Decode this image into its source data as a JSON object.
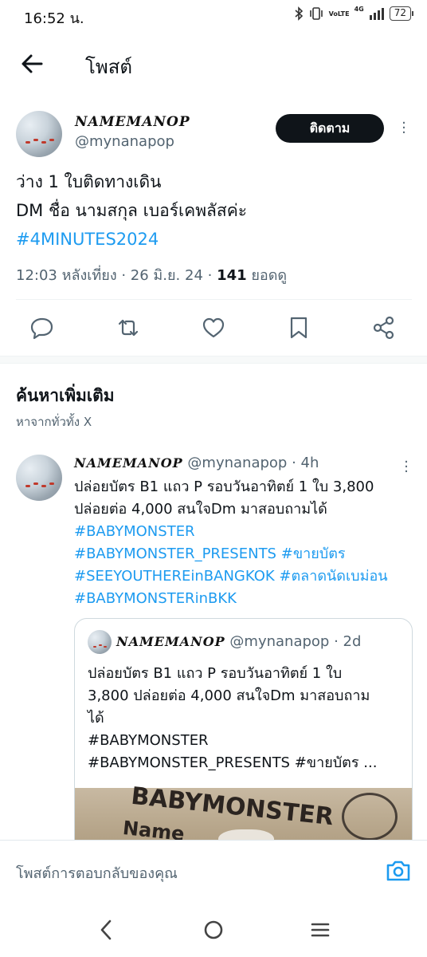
{
  "status_bar": {
    "time": "16:52 น.",
    "network": "VoLTE",
    "network_type": "4G",
    "battery": "72"
  },
  "header": {
    "title": "โพสต์",
    "back_icon": "arrow-left-icon"
  },
  "post": {
    "author_name": "NAMEMANOP",
    "handle": "@mynanapop",
    "follow_label": "ติดตาม",
    "lines": [
      "ว่าง 1 ใบติดทางเดิน",
      "DM ชื่อ นามสกุล เบอร์เคพลัสค่ะ"
    ],
    "hashtag": "#4MINUTES2024",
    "time": "12:03 หลังเที่ยง · 26 มิ.ย. 24 · ",
    "views_count": "141",
    "views_label": " ยอดดู",
    "actions": [
      "reply-icon",
      "retweet-icon",
      "like-icon",
      "bookmark-icon",
      "share-icon"
    ]
  },
  "discover": {
    "title": "ค้นหาเพิ่มเติม",
    "subtitle": "หาจากทั่วทั้ง X"
  },
  "tweet2": {
    "author_name": "NAMEMANOP",
    "handle": "@mynanapop",
    "time": " · 4h",
    "text_line1": "ปล่อยบัตร B1 แถว P รอบวันอาทิตย์ 1 ใบ 3,800",
    "text_line2": "ปล่อยต่อ 4,000 สนใจDm มาสอบถามได้",
    "tag1": "#BABYMONSTER",
    "tag2": "#BABYMONSTER_PRESENTS",
    "tag3": "#ขายบัตร",
    "tag4": "#SEEYOUTHEREinBANGKOK",
    "tag5": "#ตลาดนัดเบม่อน",
    "tag6": "#BABYMONSTERinBKK"
  },
  "quote": {
    "author_name": "NAMEMANOP",
    "handle": "@mynanapop",
    "time": " · 2d",
    "line1": "ปล่อยบัตร B1 แถว P รอบวันอาทิตย์ 1 ใบ",
    "line2": "3,800 ปล่อยต่อ 4,000 สนใจDm มาสอบถาม",
    "line3": "ได้",
    "line4": "#BABYMONSTER",
    "line5": "#BABYMONSTER_PRESENTS #ขายบัตร ...",
    "image_text1": "BABYMONSTER",
    "image_text2": "Name"
  },
  "reply_bar": {
    "placeholder": "โพสต์การตอบกลับของคุณ",
    "icon": "camera-icon"
  },
  "nav_bar": {
    "icons": [
      "back-nav-icon",
      "home-nav-icon",
      "recents-nav-icon"
    ]
  },
  "colors": {
    "accent": "#1d9bf0",
    "text": "#0f1419",
    "secondary": "#536471"
  }
}
